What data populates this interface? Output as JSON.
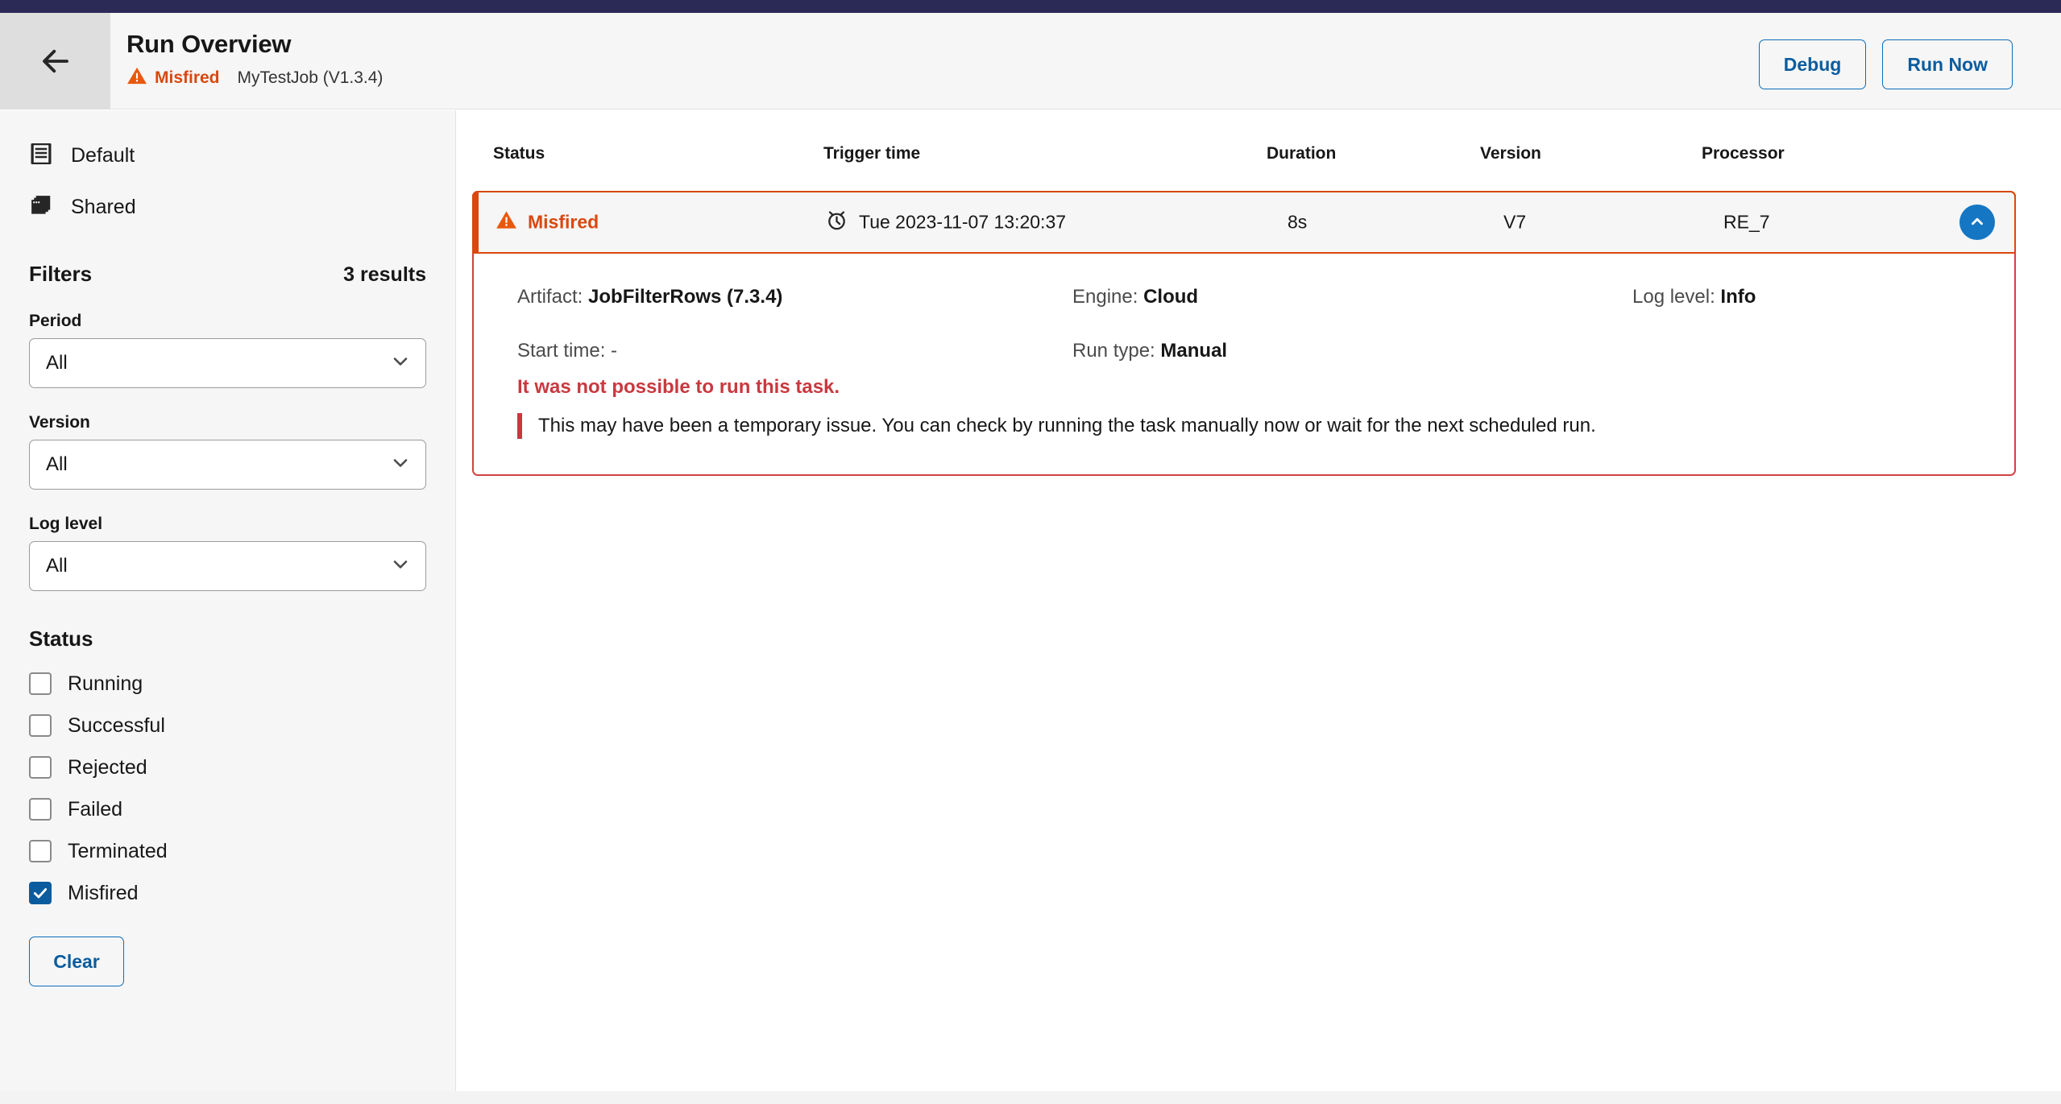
{
  "header": {
    "back_icon": "arrow-left-icon",
    "title": "Run Overview",
    "status_icon": "warning-triangle-icon",
    "status": "Misfired",
    "job_name": "MyTestJob (V1.3.4)",
    "debug_label": "Debug",
    "run_now_label": "Run Now"
  },
  "sidebar": {
    "nav": [
      {
        "icon": "list-document-icon",
        "label": "Default"
      },
      {
        "icon": "stacked-cards-icon",
        "label": "Shared"
      }
    ],
    "filters_title": "Filters",
    "results_count": "3 results",
    "fields": [
      {
        "label": "Period",
        "value": "All",
        "chevron": "chevron-down-icon"
      },
      {
        "label": "Version",
        "value": "All",
        "chevron": "chevron-down-icon"
      },
      {
        "label": "Log level",
        "value": "All",
        "chevron": "chevron-down-icon"
      }
    ],
    "status_title": "Status",
    "status_options": [
      {
        "label": "Running",
        "checked": false
      },
      {
        "label": "Successful",
        "checked": false
      },
      {
        "label": "Rejected",
        "checked": false
      },
      {
        "label": "Failed",
        "checked": false
      },
      {
        "label": "Terminated",
        "checked": false
      },
      {
        "label": "Misfired",
        "checked": true
      }
    ],
    "clear_label": "Clear"
  },
  "table": {
    "columns": [
      {
        "label": "Status"
      },
      {
        "label": "Trigger time"
      },
      {
        "label": "Duration"
      },
      {
        "label": "Version"
      },
      {
        "label": "Processor"
      }
    ],
    "row": {
      "status_icon": "warning-triangle-icon",
      "status": "Misfired",
      "trigger_icon": "alarm-clock-icon",
      "trigger_time": "Tue 2023-11-07 13:20:37",
      "duration": "8s",
      "version": "V7",
      "processor": "RE_7",
      "expand_icon": "chevron-up-icon"
    },
    "detail": {
      "artifact_label": "Artifact:",
      "artifact_value": "JobFilterRows (7.3.4)",
      "engine_label": "Engine:",
      "engine_value": "Cloud",
      "loglevel_label": "Log level:",
      "loglevel_value": "Info",
      "starttime_label": "Start time:",
      "starttime_value": "-",
      "runtype_label": "Run type:",
      "runtype_value": "Manual",
      "error_title": "It was not possible to run this task.",
      "error_body": "This may have been a temporary issue. You can check by running the task manually now or wait for the next scheduled run."
    }
  },
  "colors": {
    "navy": "#2b2a57",
    "accent_blue": "#0a5c9e",
    "warning_orange": "#d9480f",
    "error_red": "#c8393f"
  }
}
